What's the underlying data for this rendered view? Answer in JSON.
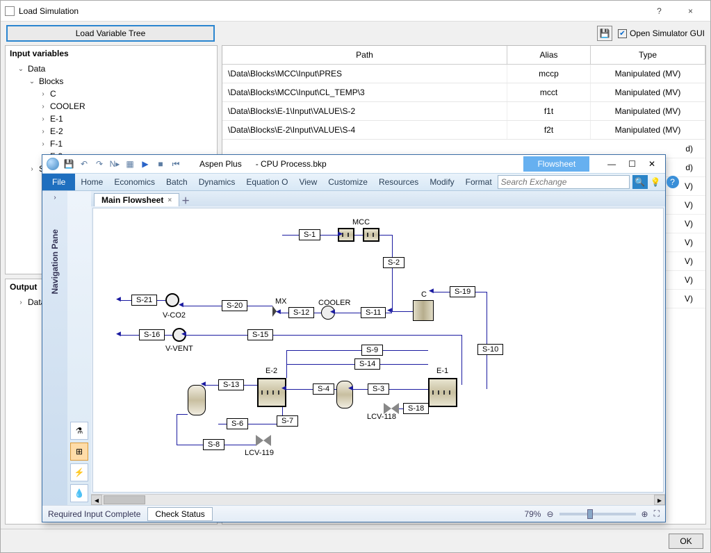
{
  "window": {
    "title": "Load Simulation",
    "help": "?",
    "close": "×"
  },
  "toolbar": {
    "load_btn": "Load Variable Tree",
    "save_icon": "💾",
    "open_sim_label": "Open Simulator GUI",
    "open_sim_checked": true
  },
  "input_panel": {
    "header": "Input variables",
    "tree": [
      {
        "label": "Data",
        "exp": "open",
        "indent": 1
      },
      {
        "label": "Blocks",
        "exp": "open",
        "indent": 2
      },
      {
        "label": "C",
        "exp": "closed",
        "indent": 3
      },
      {
        "label": "COOLER",
        "exp": "closed",
        "indent": 3
      },
      {
        "label": "E-1",
        "exp": "closed",
        "indent": 3
      },
      {
        "label": "E-2",
        "exp": "closed",
        "indent": 3
      },
      {
        "label": "F-1",
        "exp": "closed",
        "indent": 3
      },
      {
        "label": "F-2",
        "exp": "closed",
        "indent": 3
      },
      {
        "label": "S",
        "exp": "closed",
        "indent": 2,
        "truncated": true
      }
    ]
  },
  "output_panel": {
    "header": "Output",
    "root": "Data"
  },
  "grid": {
    "cols": {
      "path": "Path",
      "alias": "Alias",
      "type": "Type"
    },
    "rows": [
      {
        "path": "\\Data\\Blocks\\MCC\\Input\\PRES",
        "alias": "mccp",
        "type": "Manipulated (MV)"
      },
      {
        "path": "\\Data\\Blocks\\MCC\\Input\\CL_TEMP\\3",
        "alias": "mcct",
        "type": "Manipulated (MV)"
      },
      {
        "path": "\\Data\\Blocks\\E-1\\Input\\VALUE\\S-2",
        "alias": "f1t",
        "type": "Manipulated (MV)"
      },
      {
        "path": "\\Data\\Blocks\\E-2\\Input\\VALUE\\S-4",
        "alias": "f2t",
        "type": "Manipulated (MV)"
      }
    ],
    "peek_types": [
      "d)",
      "d)",
      "V)",
      "V)",
      "V)",
      "V)",
      "V)",
      "V)",
      "V)"
    ]
  },
  "footer": {
    "ok": "OK"
  },
  "aspen": {
    "title_app": "Aspen Plus",
    "title_file": "- CPU Process.bkp",
    "sim_tab": "Flowsheet",
    "min": "—",
    "max": "☐",
    "close": "✕",
    "ribbon": {
      "file": "File",
      "tabs": [
        "Home",
        "Economics",
        "Batch",
        "Dynamics",
        "Equation O",
        "View",
        "Customize",
        "Resources",
        "Modify",
        "Format"
      ],
      "search_ph": "Search Exchange",
      "search_icon": "🔍"
    },
    "navpane": "Navigation Pane",
    "canvas_tab": "Main Flowsheet",
    "add_tab": "＋",
    "blocks": {
      "mcc": "MCC",
      "cooler": "COOLER",
      "mx": "MX",
      "c": "C",
      "e1": "E-1",
      "e2": "E-2",
      "vco2": "V-CO2",
      "vvent": "V-VENT",
      "lcv118": "LCV-118",
      "lcv119": "LCV-119"
    },
    "streams": {
      "s1": "S-1",
      "s2": "S-2",
      "s3": "S-3",
      "s4": "S-4",
      "s6": "S-6",
      "s7": "S-7",
      "s8": "S-8",
      "s9": "S-9",
      "s10": "S-10",
      "s11": "S-11",
      "s12": "S-12",
      "s13": "S-13",
      "s14": "S-14",
      "s15": "S-15",
      "s16": "S-16",
      "s18": "S-18",
      "s19": "S-19",
      "s20": "S-20",
      "s21": "S-21"
    },
    "status": {
      "msg": "Required Input Complete",
      "check": "Check Status",
      "zoom": "79%",
      "minus": "⊖",
      "plus": "⊕"
    }
  }
}
